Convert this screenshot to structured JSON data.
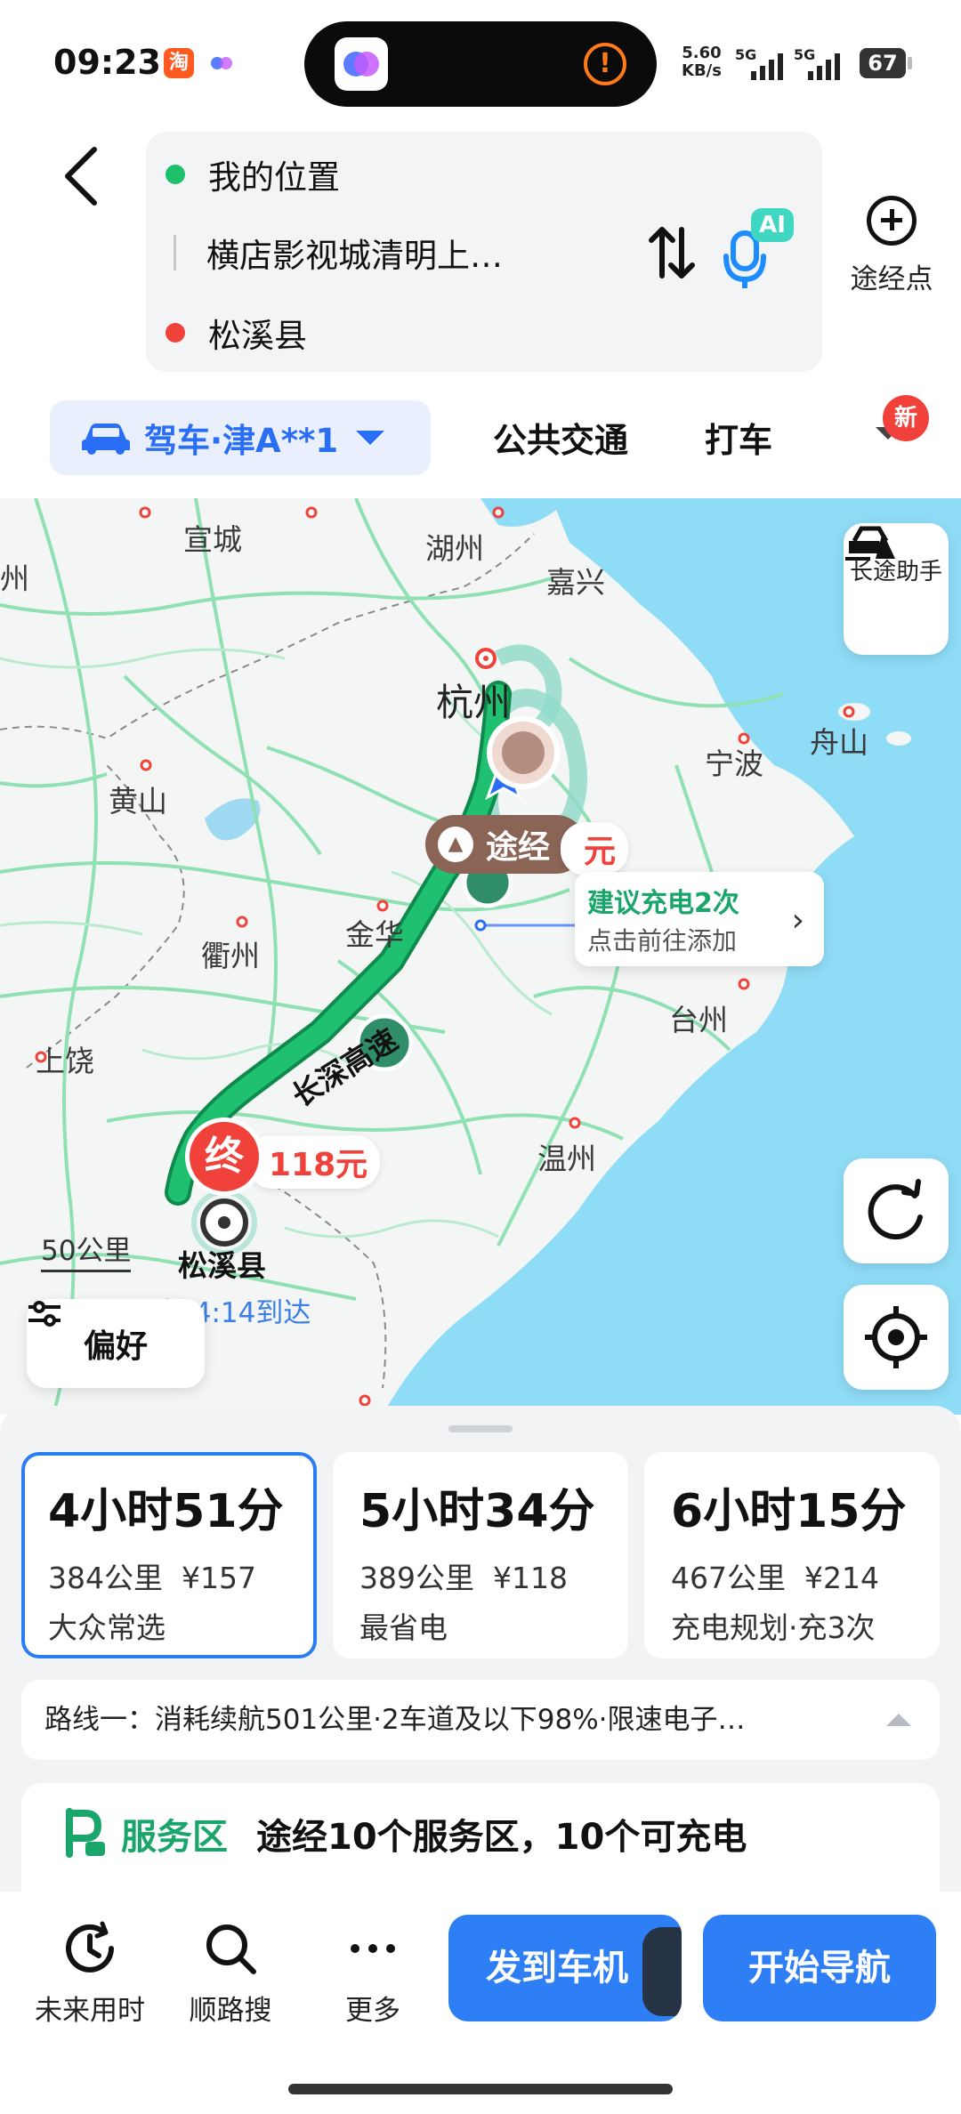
{
  "status_bar": {
    "time": "09:23",
    "app_badge": "淘",
    "net_speed_value": "5.60",
    "net_speed_unit": "KB/s",
    "signal_1": "5G",
    "signal_2": "5G",
    "battery": "67"
  },
  "route": {
    "origin": "我的位置",
    "waypoint": "横店影视城清明上…",
    "destination": "松溪县",
    "ai_badge": "AI",
    "add_waypoint_label": "途经点"
  },
  "modes": {
    "drive_label": "驾车·津A**1",
    "transit_label": "公共交通",
    "taxi_label": "打车",
    "new_badge": "新"
  },
  "map": {
    "cities": {
      "xuancheng": "宣城",
      "huzhou": "湖州",
      "jiaxing": "嘉兴",
      "hangzhou": "杭州",
      "zhoushan": "舟山",
      "ningbo": "宁波",
      "huangshan": "黄山",
      "jinhua": "金华",
      "quzhou": "衢州",
      "taizhou": "台州",
      "shangrao": "上饶",
      "wenzhou": "温州",
      "songxi": "松溪县",
      "zhou_partial": "州"
    },
    "highway_label": "长深高速",
    "via_chip": "途经",
    "via_price_partial": "元",
    "charge_tip_title": "建议充电2次",
    "charge_tip_sub": "点击前往添加",
    "end_marker": "终",
    "end_price": "118元",
    "scale": "50公里",
    "eta": "预计14:14到达",
    "long_trip_label": "长途助手",
    "preference_label": "偏好"
  },
  "routes": [
    {
      "time": "4小时51分",
      "distance": "384公里",
      "cost": "¥157",
      "tag": "大众常选"
    },
    {
      "time": "5小时34分",
      "distance": "389公里",
      "cost": "¥118",
      "tag": "最省电"
    },
    {
      "time": "6小时15分",
      "distance": "467公里",
      "cost": "¥214",
      "tag": "充电规划·充3次"
    }
  ],
  "route_desc": "路线一：消耗续航501公里·2车道及以下98%·限速电子…",
  "service": {
    "label": "服务区",
    "text": "途经10个服务区，10个可充电"
  },
  "actions": {
    "future_time": "未来用时",
    "along_search": "顺路搜",
    "more": "更多",
    "send_to_car": "发到车机",
    "start_nav": "开始导航"
  },
  "colors": {
    "accent_blue": "#2a6ef5",
    "route_green": "#1aa56a",
    "alert_red": "#f0413a",
    "via_brown": "#8a6556"
  }
}
